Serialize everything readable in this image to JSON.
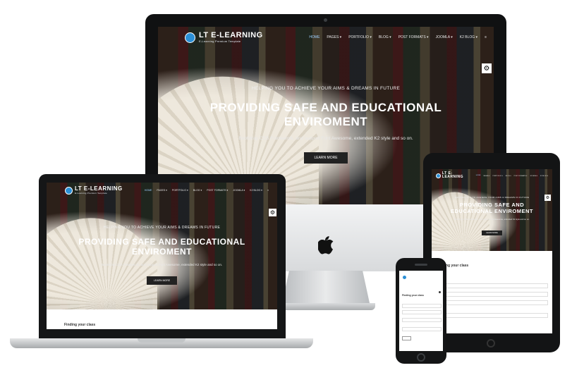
{
  "brand": {
    "name": "LT E-LEARNING",
    "tagline": "E-Learning Premium Template"
  },
  "nav": {
    "items": [
      "HOME",
      "PAGES ▾",
      "PORTFOLIO ▾",
      "BLOG ▾",
      "POST FORMATS ▾",
      "JOOMLA ▾",
      "K2 BLOG ▾"
    ],
    "menu_icon": "hamburger-icon"
  },
  "hero": {
    "eyebrow": "HELPING YOU TO ACHIEVE YOUR AIMS & DREAMS IN FUTURE",
    "headline": "PROVIDING SAFE AND EDUCATIONAL ENVIROMENT",
    "subline": "Bootstrap CSS Framework, and support Font Awesome, extended K2 style and so on.",
    "button": "LEARN MORE"
  },
  "section": {
    "finding_class": "Finding your class"
  },
  "icons": {
    "settings": "gear-icon",
    "brand_logo": "apple-logo-icon"
  },
  "colors": {
    "accent": "#2b8fd6",
    "device_frame": "#131415",
    "button": "#222222"
  }
}
